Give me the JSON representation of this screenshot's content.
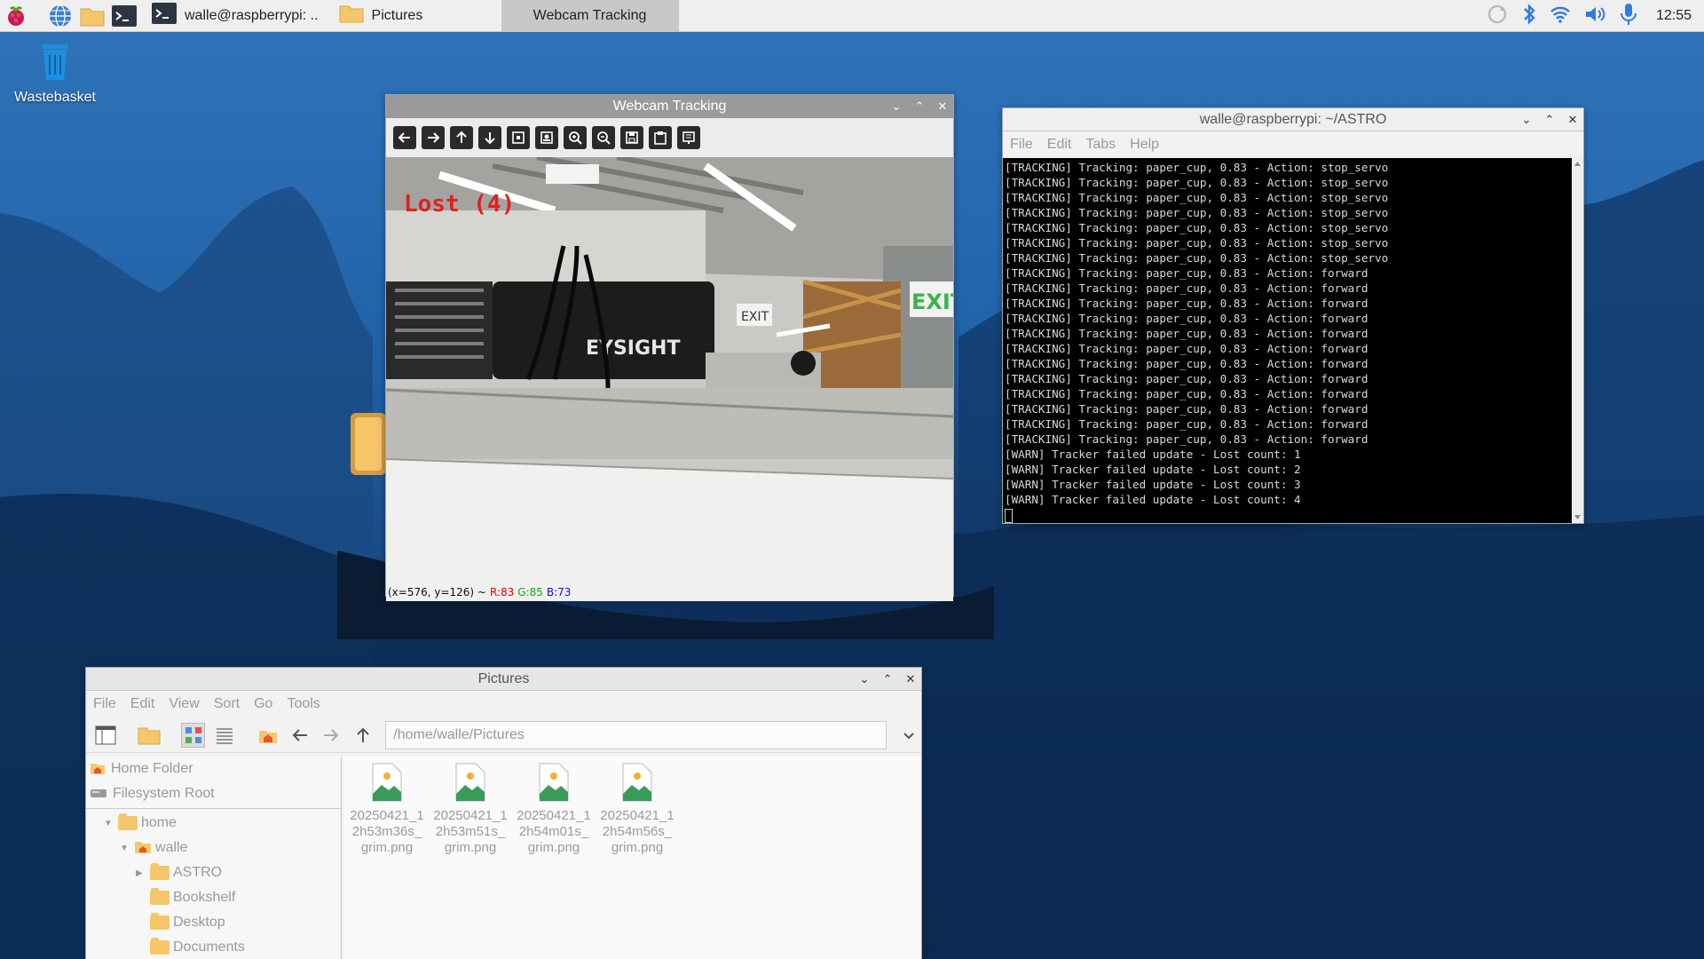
{
  "taskbar": {
    "tasks": [
      {
        "label": "walle@raspberrypi: ..",
        "icon": "terminal-icon"
      },
      {
        "label": "Pictures",
        "icon": "folder-icon"
      },
      {
        "label": "Webcam Tracking",
        "icon": ""
      }
    ],
    "clock": "12:55"
  },
  "desktop": {
    "icons": [
      {
        "label": "Wastebasket",
        "icon": "wastebasket-icon"
      }
    ]
  },
  "webcam_window": {
    "title": "Webcam Tracking",
    "overlay_text": "Lost (4)",
    "status": {
      "coords": "(x=576, y=126) ~",
      "r": "R:83",
      "g": "G:85",
      "b": "B:73"
    },
    "camera_text": {
      "brand": "EYSIGHT",
      "exit_sign": "EXIT"
    }
  },
  "terminal_window": {
    "title": "walle@raspberrypi: ~/ASTRO",
    "menu": [
      "File",
      "Edit",
      "Tabs",
      "Help"
    ],
    "lines": [
      "[TRACKING] Tracking: paper_cup, 0.83 - Action: stop_servo",
      "[TRACKING] Tracking: paper_cup, 0.83 - Action: stop_servo",
      "[TRACKING] Tracking: paper_cup, 0.83 - Action: stop_servo",
      "[TRACKING] Tracking: paper_cup, 0.83 - Action: stop_servo",
      "[TRACKING] Tracking: paper_cup, 0.83 - Action: stop_servo",
      "[TRACKING] Tracking: paper_cup, 0.83 - Action: stop_servo",
      "[TRACKING] Tracking: paper_cup, 0.83 - Action: stop_servo",
      "[TRACKING] Tracking: paper_cup, 0.83 - Action: forward",
      "[TRACKING] Tracking: paper_cup, 0.83 - Action: forward",
      "[TRACKING] Tracking: paper_cup, 0.83 - Action: forward",
      "[TRACKING] Tracking: paper_cup, 0.83 - Action: forward",
      "[TRACKING] Tracking: paper_cup, 0.83 - Action: forward",
      "[TRACKING] Tracking: paper_cup, 0.83 - Action: forward",
      "[TRACKING] Tracking: paper_cup, 0.83 - Action: forward",
      "[TRACKING] Tracking: paper_cup, 0.83 - Action: forward",
      "[TRACKING] Tracking: paper_cup, 0.83 - Action: forward",
      "[TRACKING] Tracking: paper_cup, 0.83 - Action: forward",
      "[TRACKING] Tracking: paper_cup, 0.83 - Action: forward",
      "[TRACKING] Tracking: paper_cup, 0.83 - Action: forward",
      "[WARN] Tracker failed update - Lost count: 1",
      "[WARN] Tracker failed update - Lost count: 2",
      "[WARN] Tracker failed update - Lost count: 3",
      "[WARN] Tracker failed update - Lost count: 4"
    ]
  },
  "file_manager": {
    "title": "Pictures",
    "menu": [
      "File",
      "Edit",
      "View",
      "Sort",
      "Go",
      "Tools"
    ],
    "path": "/home/walle/Pictures",
    "places": [
      {
        "label": "Home Folder",
        "icon": "home-icon"
      },
      {
        "label": "Filesystem Root",
        "icon": "drive-icon"
      }
    ],
    "tree": [
      {
        "label": "home",
        "level": 1,
        "expanded": true
      },
      {
        "label": "walle",
        "level": 2,
        "expanded": true
      },
      {
        "label": "ASTRO",
        "level": 3,
        "expanded": false
      },
      {
        "label": "Bookshelf",
        "level": 3
      },
      {
        "label": "Desktop",
        "level": 3
      },
      {
        "label": "Documents",
        "level": 3
      }
    ],
    "files": [
      {
        "line1": "20250421_1",
        "line2": "2h53m36s_",
        "line3": "grim.png"
      },
      {
        "line1": "20250421_1",
        "line2": "2h53m51s_",
        "line3": "grim.png"
      },
      {
        "line1": "20250421_1",
        "line2": "2h54m01s_",
        "line3": "grim.png"
      },
      {
        "line1": "20250421_1",
        "line2": "2h54m56s_",
        "line3": "grim.png"
      }
    ]
  },
  "colors": {
    "accent": "#2a6cb3",
    "overlay_red": "#e02020",
    "terminal_bg": "#000000"
  }
}
